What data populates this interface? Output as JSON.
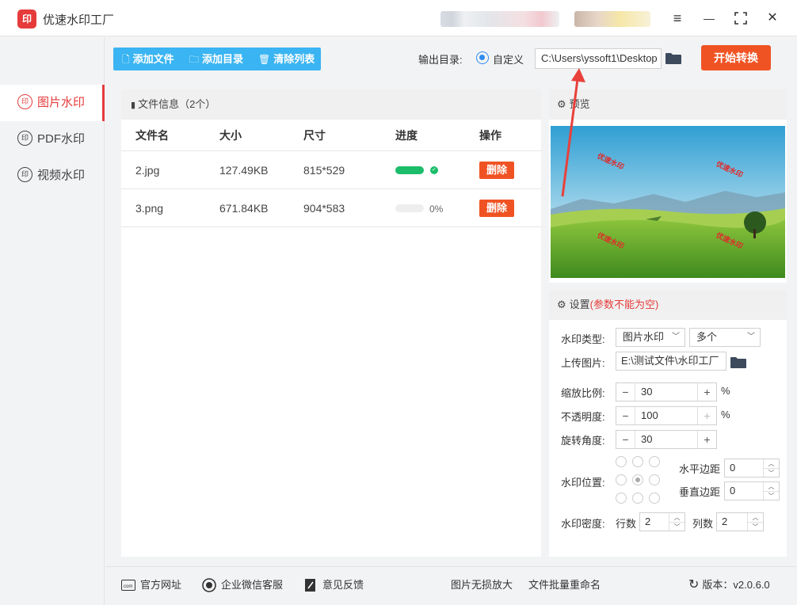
{
  "app": {
    "title": "优速水印工厂",
    "logo_glyph": "印",
    "window_controls": {
      "menu": "≡",
      "minimize": "—",
      "maximize": "⛶",
      "close": "✕"
    }
  },
  "sidebar": {
    "items": [
      {
        "label": "图片水印",
        "active": true
      },
      {
        "label": "PDF水印",
        "active": false
      },
      {
        "label": "视频水印",
        "active": false
      }
    ]
  },
  "toolbar": {
    "add_file": "添加文件",
    "add_dir": "添加目录",
    "clear_list": "清除列表",
    "output_label": "输出目录:",
    "custom_label": "自定义",
    "output_path": "C:\\Users\\yssoft1\\Desktop",
    "start_button": "开始转换"
  },
  "file_panel": {
    "header": "文件信息（2个）",
    "columns": [
      "文件名",
      "大小",
      "尺寸",
      "进度",
      "操作"
    ],
    "rows": [
      {
        "name": "2.jpg",
        "size": "127.49KB",
        "dims": "815*529",
        "progress": 1.0,
        "progress_text": "",
        "action": "删除"
      },
      {
        "name": "3.png",
        "size": "671.84KB",
        "dims": "904*583",
        "progress": 0.0,
        "progress_text": "0%",
        "action": "删除"
      }
    ]
  },
  "preview": {
    "header": "预览",
    "watermark_text": "优速水印"
  },
  "settings": {
    "header": "设置",
    "warning": "(参数不能为空)",
    "watermark_type_label": "水印类型:",
    "watermark_type_value": "图片水印",
    "multi_value": "多个",
    "upload_label": "上传图片:",
    "upload_path": "E:\\测试文件\\水印工厂",
    "scale_label": "缩放比例:",
    "scale_value": "30",
    "opacity_label": "不透明度:",
    "opacity_value": "100",
    "rotation_label": "旋转角度:",
    "rotation_value": "30",
    "percent": "%",
    "position_label": "水印位置:",
    "h_margin_label": "水平边距",
    "h_margin_value": "0",
    "v_margin_label": "垂直边距",
    "v_margin_value": "0",
    "density_label": "水印密度:",
    "rows_label": "行数",
    "rows_value": "2",
    "cols_label": "列数",
    "cols_value": "2"
  },
  "footer": {
    "website": "官方网址",
    "wechat": "企业微信客服",
    "feedback": "意见反馈",
    "lossless": "图片无损放大",
    "batch_rename": "文件批量重命名",
    "version": "版本：v2.0.6.0"
  },
  "colors": {
    "accent_red": "#e53b3b",
    "toolbar_blue": "#3ab4f2",
    "start_orange": "#f05323",
    "progress_green": "#1cbd6a",
    "radio_blue": "#2d8cf0"
  }
}
